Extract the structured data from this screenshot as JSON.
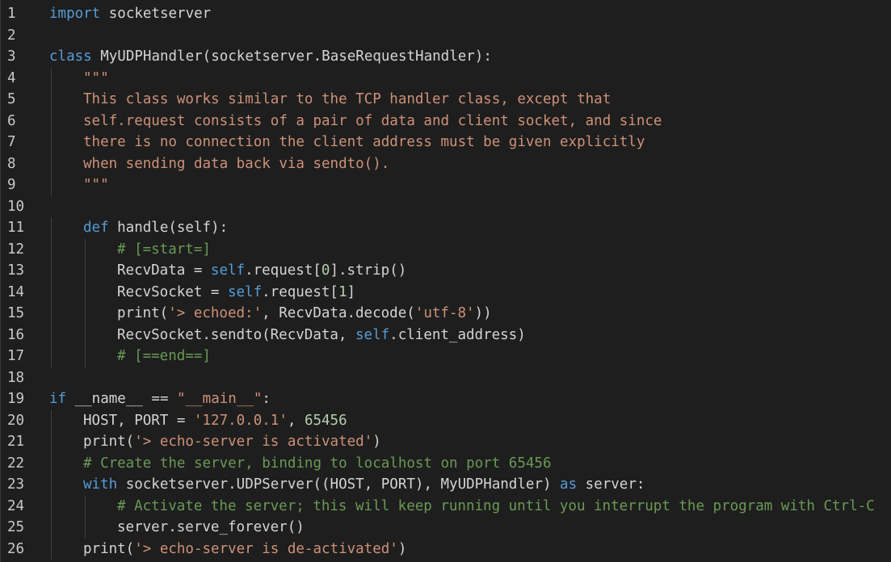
{
  "colors": {
    "background": "#1e1e1e",
    "keyword": "#569cd6",
    "string": "#ce9178",
    "comment": "#6a9955",
    "number": "#b5cea8",
    "default": "#d4d4d4",
    "line_number": "#c8c8c8"
  },
  "lines": [
    {
      "n": "1",
      "indent": 0,
      "tokens": [
        [
          "kw",
          "import"
        ],
        [
          "txt",
          " socketserver"
        ]
      ]
    },
    {
      "n": "2",
      "indent": 0,
      "tokens": []
    },
    {
      "n": "3",
      "indent": 0,
      "tokens": [
        [
          "kw",
          "class"
        ],
        [
          "txt",
          " MyUDPHandler(socketserver.BaseRequestHandler):"
        ]
      ]
    },
    {
      "n": "4",
      "indent": 1,
      "tokens": [
        [
          "str",
          "\"\"\""
        ]
      ]
    },
    {
      "n": "5",
      "indent": 1,
      "tokens": [
        [
          "str",
          "This class works similar to the TCP handler class, except that"
        ]
      ]
    },
    {
      "n": "6",
      "indent": 1,
      "tokens": [
        [
          "str",
          "self.request consists of a pair of data and client socket, and since"
        ]
      ]
    },
    {
      "n": "7",
      "indent": 1,
      "tokens": [
        [
          "str",
          "there is no connection the client address must be given explicitly"
        ]
      ]
    },
    {
      "n": "8",
      "indent": 1,
      "tokens": [
        [
          "str",
          "when sending data back via sendto()."
        ]
      ]
    },
    {
      "n": "9",
      "indent": 1,
      "tokens": [
        [
          "str",
          "\"\"\""
        ]
      ]
    },
    {
      "n": "10",
      "indent": 0,
      "tokens": []
    },
    {
      "n": "11",
      "indent": 1,
      "tokens": [
        [
          "kw",
          "def"
        ],
        [
          "txt",
          " handle(self):"
        ]
      ]
    },
    {
      "n": "12",
      "indent": 2,
      "tokens": [
        [
          "cmt",
          "# [=start=]"
        ]
      ]
    },
    {
      "n": "13",
      "indent": 2,
      "tokens": [
        [
          "txt",
          "RecvData = "
        ],
        [
          "kw",
          "self"
        ],
        [
          "txt",
          ".request["
        ],
        [
          "num",
          "0"
        ],
        [
          "txt",
          "].strip()"
        ]
      ]
    },
    {
      "n": "14",
      "indent": 2,
      "tokens": [
        [
          "txt",
          "RecvSocket = "
        ],
        [
          "kw",
          "self"
        ],
        [
          "txt",
          ".request["
        ],
        [
          "num",
          "1"
        ],
        [
          "txt",
          "]"
        ]
      ]
    },
    {
      "n": "15",
      "indent": 2,
      "tokens": [
        [
          "txt",
          "print("
        ],
        [
          "str",
          "'> echoed:'"
        ],
        [
          "txt",
          ", RecvData.decode("
        ],
        [
          "str",
          "'utf-8'"
        ],
        [
          "txt",
          "))"
        ]
      ]
    },
    {
      "n": "16",
      "indent": 2,
      "tokens": [
        [
          "txt",
          "RecvSocket.sendto(RecvData, "
        ],
        [
          "kw",
          "self"
        ],
        [
          "txt",
          ".client_address)"
        ]
      ]
    },
    {
      "n": "17",
      "indent": 2,
      "tokens": [
        [
          "cmt",
          "# [==end==]"
        ]
      ]
    },
    {
      "n": "18",
      "indent": 0,
      "tokens": []
    },
    {
      "n": "19",
      "indent": 0,
      "tokens": [
        [
          "kw",
          "if"
        ],
        [
          "txt",
          " __name__ == "
        ],
        [
          "str",
          "\"__main__\""
        ],
        [
          "txt",
          ":"
        ]
      ]
    },
    {
      "n": "20",
      "indent": 1,
      "tokens": [
        [
          "txt",
          "HOST, PORT = "
        ],
        [
          "str",
          "'127.0.0.1'"
        ],
        [
          "txt",
          ", "
        ],
        [
          "num",
          "65456"
        ]
      ]
    },
    {
      "n": "21",
      "indent": 1,
      "tokens": [
        [
          "txt",
          "print("
        ],
        [
          "str",
          "'> echo-server is activated'"
        ],
        [
          "txt",
          ")"
        ]
      ]
    },
    {
      "n": "22",
      "indent": 1,
      "tokens": [
        [
          "cmt",
          "# Create the server, binding to localhost on port 65456"
        ]
      ]
    },
    {
      "n": "23",
      "indent": 1,
      "tokens": [
        [
          "kw",
          "with"
        ],
        [
          "txt",
          " socketserver.UDPServer((HOST, PORT), MyUDPHandler) "
        ],
        [
          "kw",
          "as"
        ],
        [
          "txt",
          " server:"
        ]
      ]
    },
    {
      "n": "24",
      "indent": 2,
      "tokens": [
        [
          "cmt",
          "# Activate the server; this will keep running until you interrupt the program with Ctrl-C"
        ]
      ]
    },
    {
      "n": "25",
      "indent": 2,
      "tokens": [
        [
          "txt",
          "server.serve_forever()"
        ]
      ]
    },
    {
      "n": "26",
      "indent": 1,
      "tokens": [
        [
          "txt",
          "print("
        ],
        [
          "str",
          "'> echo-server is de-activated'"
        ],
        [
          "txt",
          ")"
        ]
      ]
    }
  ]
}
